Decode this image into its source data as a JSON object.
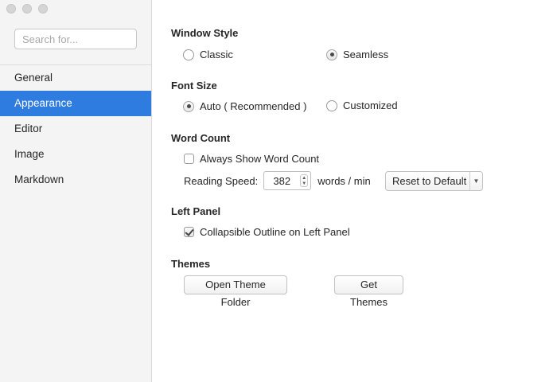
{
  "sidebar": {
    "search_placeholder": "Search for...",
    "items": [
      {
        "label": "General"
      },
      {
        "label": "Appearance"
      },
      {
        "label": "Editor"
      },
      {
        "label": "Image"
      },
      {
        "label": "Markdown"
      }
    ],
    "active_index": 1,
    "accent_color": "#2f7ce0"
  },
  "window_style": {
    "title": "Window Style",
    "options": [
      "Classic",
      "Seamless"
    ],
    "selected": "Seamless"
  },
  "font_size": {
    "title": "Font Size",
    "options": [
      "Auto ( Recommended )",
      "Customized"
    ],
    "selected": "Auto ( Recommended )"
  },
  "word_count": {
    "title": "Word Count",
    "always_show_label": "Always Show Word Count",
    "always_show_checked": false,
    "reading_speed_label": "Reading Speed:",
    "reading_speed_value": "382",
    "units_label": "words / min",
    "reset_label": "Reset to Default"
  },
  "left_panel": {
    "title": "Left Panel",
    "collapsible_label": "Collapsible Outline on Left Panel",
    "collapsible_checked": true
  },
  "themes": {
    "title": "Themes",
    "open_folder_label": "Open Theme Folder",
    "get_themes_label": "Get Themes"
  }
}
